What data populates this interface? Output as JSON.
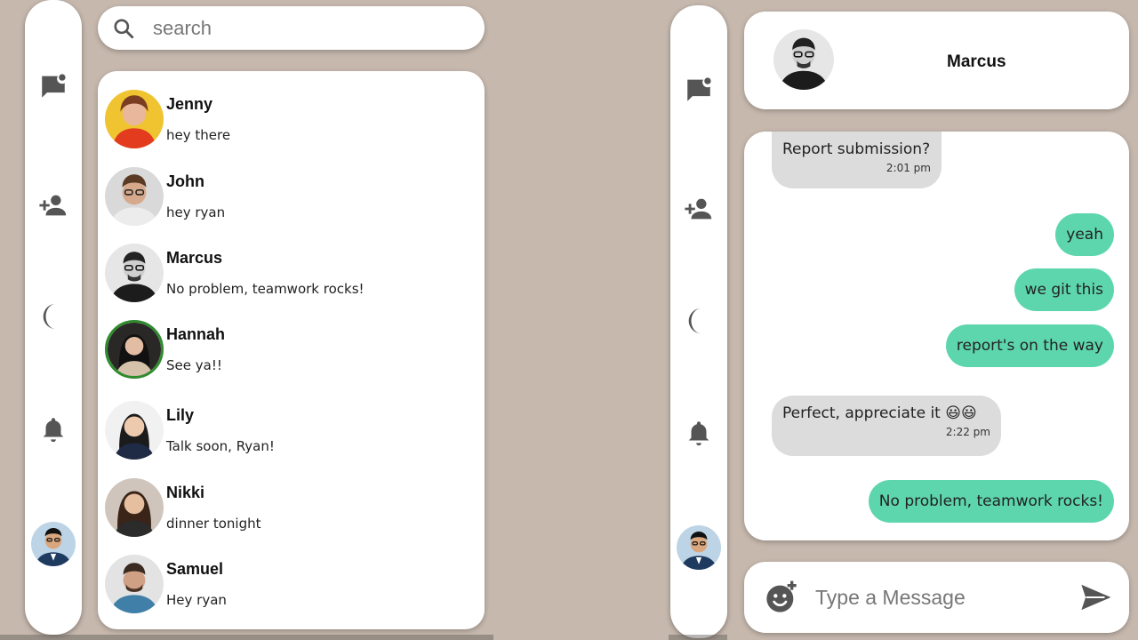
{
  "search": {
    "placeholder": "search"
  },
  "chats": [
    {
      "name": "Jenny",
      "preview": "hey there",
      "online": false
    },
    {
      "name": "John",
      "preview": "hey ryan",
      "online": false
    },
    {
      "name": "Marcus",
      "preview": "No problem, teamwork rocks!",
      "online": false
    },
    {
      "name": "Hannah",
      "preview": "See ya!!",
      "online": true
    },
    {
      "name": "Lily",
      "preview": "Talk soon, Ryan!",
      "online": false
    },
    {
      "name": "Nikki",
      "preview": "dinner tonight",
      "online": false
    },
    {
      "name": "Samuel",
      "preview": "Hey ryan",
      "online": false
    }
  ],
  "rail": {
    "icons": [
      "chat-icon",
      "add-user-icon",
      "dark-mode-icon",
      "bell-icon"
    ]
  },
  "conversation": {
    "contact_name": "Marcus",
    "messages": [
      {
        "direction": "in",
        "text": "Report submission?",
        "time": "2:01 pm"
      },
      {
        "direction": "out",
        "text": "yeah"
      },
      {
        "direction": "out",
        "text": "we git this"
      },
      {
        "direction": "out",
        "text": "report's on the way"
      },
      {
        "direction": "in",
        "text": "Perfect, appreciate it 😃😃",
        "time": "2:22 pm"
      },
      {
        "direction": "out",
        "text": "No problem, teamwork rocks!"
      }
    ]
  },
  "composer": {
    "placeholder": "Type a Message"
  },
  "colors": {
    "background": "#c6b8ad",
    "outgoing_bubble": "#5dd6ad",
    "incoming_bubble": "#dcdcdc",
    "online_ring": "#2e8b2e"
  }
}
